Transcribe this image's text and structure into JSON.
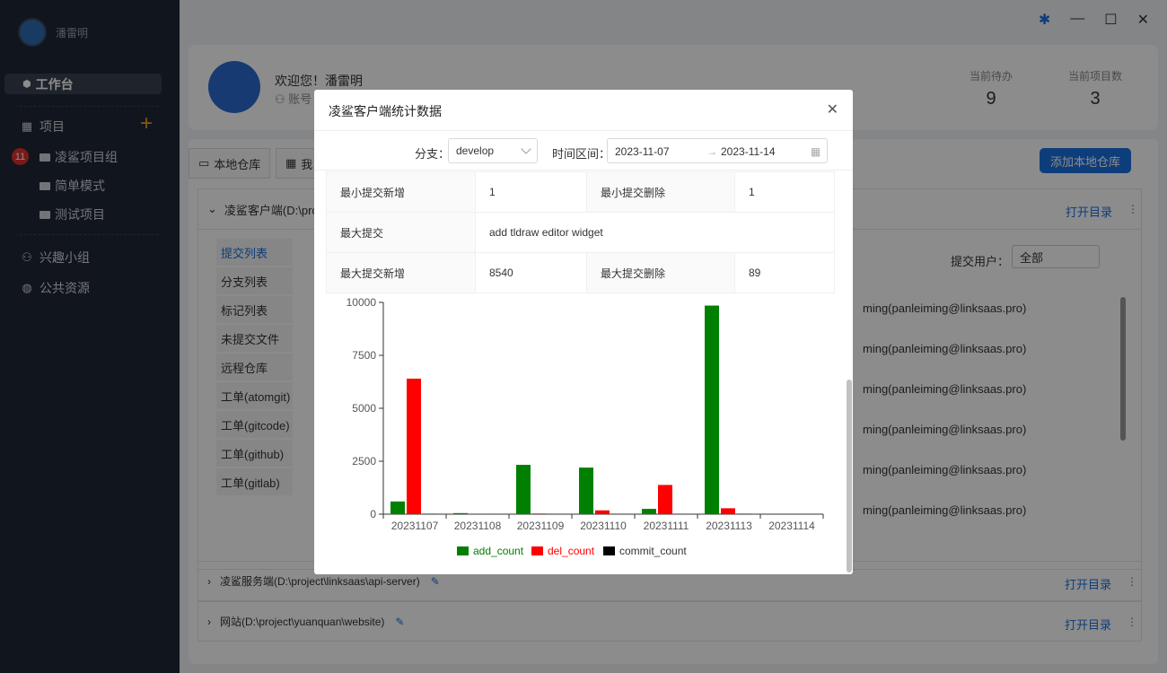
{
  "sidebar": {
    "username": "潘雷明",
    "workbench": "工作台",
    "project": "项目",
    "group_badge": "11",
    "projects": [
      "凌鲨项目组",
      "简单模式",
      "测试项目"
    ],
    "interest": "兴趣小组",
    "public": "公共资源"
  },
  "header": {
    "welcome": "欢迎您！潘雷明",
    "account": "账号",
    "todo_label": "当前待办",
    "todo_value": "9",
    "projects_label": "当前项目数",
    "projects_value": "3"
  },
  "tabs": {
    "local": "本地仓库",
    "mine": "我",
    "add_repo": "添加本地仓库"
  },
  "repos": [
    {
      "name": "凌鲨客户端(D:\\proj",
      "open": "打开目录"
    },
    {
      "name": "凌鲨服务端(D:\\project\\linksaas\\api-server)",
      "open": "打开目录"
    },
    {
      "name": "网站(D:\\project\\yuanquan\\website)",
      "open": "打开目录"
    }
  ],
  "left_menu": [
    "提交列表",
    "分支列表",
    "标记列表",
    "未提交文件",
    "远程仓库",
    "工单(atomgit)",
    "工单(gitcode)",
    "工单(github)",
    "工单(gitlab)"
  ],
  "filter": {
    "user_label": "提交用户：",
    "user_value": "全部"
  },
  "commits": [
    "ming(panleiming@linksaas.pro)",
    "ming(panleiming@linksaas.pro)",
    "ming(panleiming@linksaas.pro)",
    "ming(panleiming@linksaas.pro)",
    "ming(panleiming@linksaas.pro)",
    "ming(panleiming@linksaas.pro)"
  ],
  "modal": {
    "title": "凌鲨客户端统计数据",
    "branch_label": "分支：",
    "branch_value": "develop",
    "range_label": "时间区间：",
    "start_date": "2023-11-07",
    "end_date": "2023-11-14",
    "table": {
      "min_add_label": "最小提交新增",
      "min_add": "1",
      "min_del_label": "最小提交删除",
      "min_del": "1",
      "max_commit_label": "最大提交",
      "max_commit": "add tldraw editor widget",
      "max_add_label": "最大提交新增",
      "max_add": "8540",
      "max_del_label": "最大提交删除",
      "max_del": "89"
    }
  },
  "chart_data": {
    "type": "bar",
    "categories": [
      "20231107",
      "20231108",
      "20231109",
      "20231110",
      "20231111",
      "20231113",
      "20231114"
    ],
    "series": [
      {
        "name": "add_count",
        "color": "#008000",
        "values": [
          600,
          50,
          2330,
          2200,
          250,
          9850,
          0
        ]
      },
      {
        "name": "del_count",
        "color": "#ff0000",
        "values": [
          6400,
          0,
          30,
          180,
          1380,
          280,
          0
        ]
      },
      {
        "name": "commit_count",
        "color": "#000000",
        "values": [
          10,
          1,
          5,
          5,
          3,
          12,
          1
        ]
      }
    ],
    "yticks": [
      "0",
      "2500",
      "5000",
      "7500",
      "10000"
    ],
    "ylim": [
      0,
      10000
    ]
  }
}
